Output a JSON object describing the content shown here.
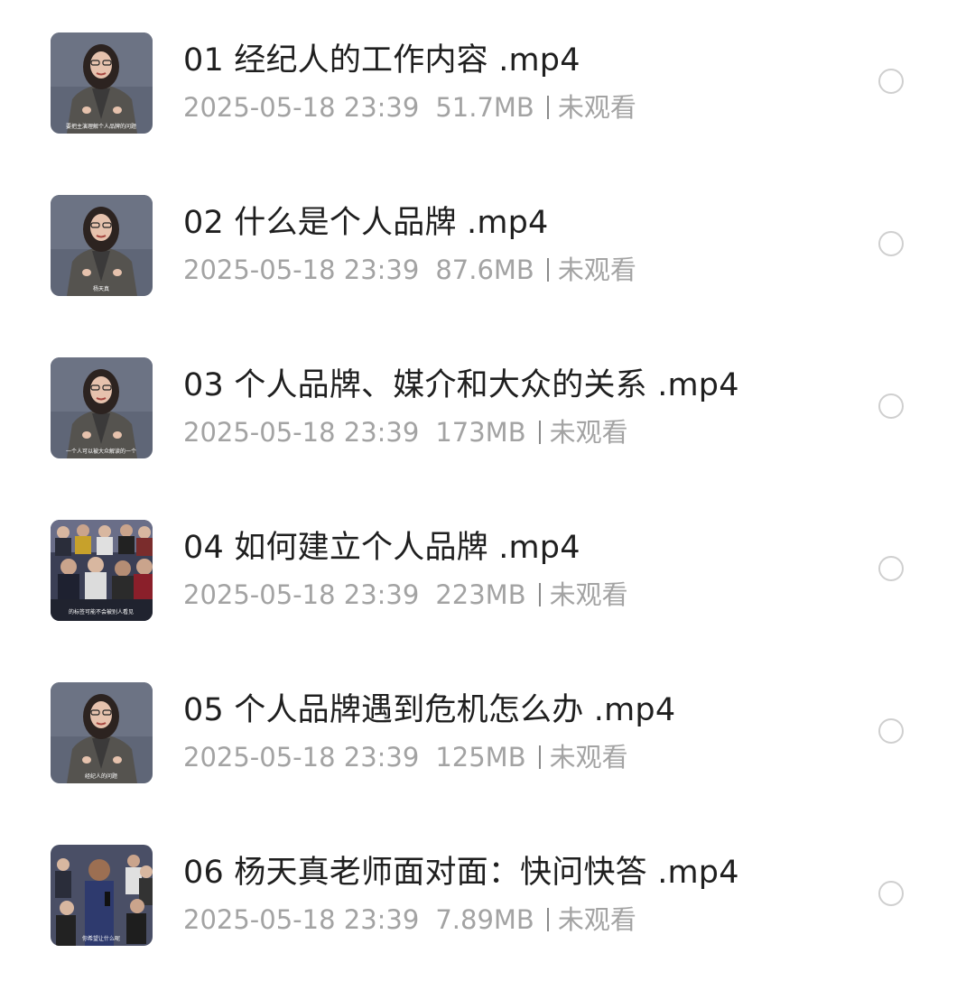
{
  "files": [
    {
      "name": "01 经纪人的工作内容 .mp4",
      "date": "2025-05-18 23:39",
      "size": "51.7MB",
      "status": "未观看",
      "thumbnail": "speaker-woman-icon",
      "caption": "要把主演理解个人品牌的问题"
    },
    {
      "name": "02 什么是个人品牌 .mp4",
      "date": "2025-05-18 23:39",
      "size": "87.6MB",
      "status": "未观看",
      "thumbnail": "speaker-woman-icon",
      "caption": "杨天真"
    },
    {
      "name": "03 个人品牌、媒介和大众的关系 .mp4",
      "date": "2025-05-18 23:39",
      "size": "173MB",
      "status": "未观看",
      "thumbnail": "speaker-woman-icon",
      "caption": "一个人可以被大众解读的一个"
    },
    {
      "name": "04 如何建立个人品牌 .mp4",
      "date": "2025-05-18 23:39",
      "size": "223MB",
      "status": "未观看",
      "thumbnail": "audience-icon",
      "caption": "的标签可能不会被别人看见"
    },
    {
      "name": "05 个人品牌遇到危机怎么办 .mp4",
      "date": "2025-05-18 23:39",
      "size": "125MB",
      "status": "未观看",
      "thumbnail": "speaker-woman-icon",
      "caption": "经纪人的问题"
    },
    {
      "name": "06 杨天真老师面对面：快问快答 .mp4",
      "date": "2025-05-18 23:39",
      "size": "7.89MB",
      "status": "未观看",
      "thumbnail": "audience-speaker-icon",
      "caption": "你希望让什么呢"
    }
  ],
  "colors": {
    "title": "#1f1f1f",
    "meta": "#a3a3a3",
    "radio": "#cfcfcf",
    "background": "#ffffff"
  }
}
